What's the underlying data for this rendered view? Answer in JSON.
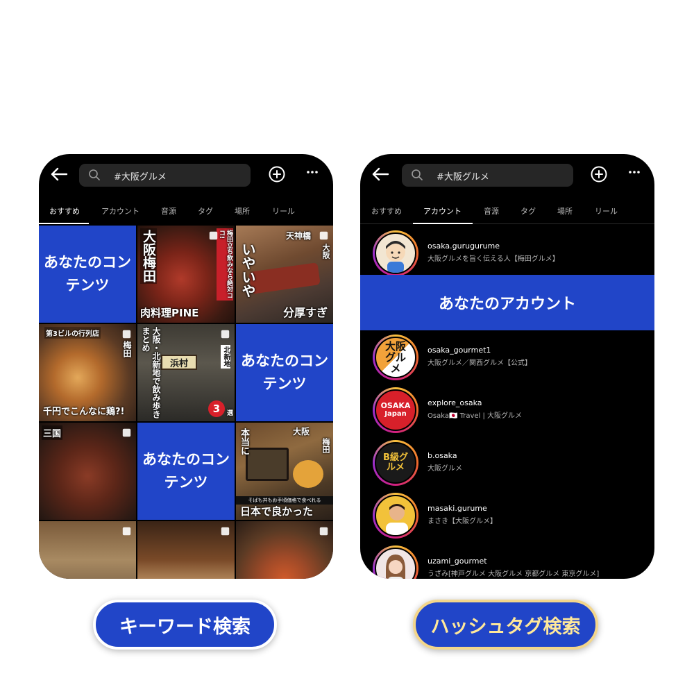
{
  "left_phone": {
    "search_text": "#大阪グルメ",
    "tabs": [
      "おすすめ",
      "アカウント",
      "音源",
      "タグ",
      "場所",
      "リール"
    ],
    "active_tab": "おすすめ",
    "your_content_label": "あなたのコンテンツ",
    "tiles": {
      "pine": {
        "big": "大阪梅田",
        "side": "梅田立ち飲みなら絶対ココ!",
        "bottom": "肉料理PINE"
      },
      "tenjin": {
        "top": "天神橋",
        "side": "大阪",
        "vert": "いやいや",
        "bottom": "分厚すぎ"
      },
      "oyakodon": {
        "top": "第3ビルの行列店",
        "side": "梅田",
        "bottom": "千円でこんなに鶏?!"
      },
      "hamamura": {
        "vert": "大阪・北新地で飲み歩きまとめ",
        "sign": "浜村",
        "side": "北新地",
        "badge": "3",
        "badge_suffix": "選"
      },
      "mikuni": {
        "top": "三国"
      },
      "soba": {
        "top": "大阪",
        "side": "梅田",
        "vert": "本当に",
        "small": "そばも丼もお手頃価格で食べれる",
        "bottom": "日本で良かった"
      }
    }
  },
  "right_phone": {
    "search_text": "#大阪グルメ",
    "tabs": [
      "おすすめ",
      "アカウント",
      "音源",
      "タグ",
      "場所",
      "リール"
    ],
    "active_tab": "アカウント",
    "your_account_label": "あなたのアカウント",
    "accounts": [
      {
        "username": "osaka.gurugurume",
        "bio": "大阪グルメを旨く伝える人【梅田グルメ】",
        "avatar_icon": "cartoon-face-icon"
      },
      {
        "username": "osaka_gourmet1",
        "bio": "大阪グルメ／関西グルメ【公式】",
        "avatar_text": "大阪グルメ"
      },
      {
        "username": "explore_osaka",
        "bio": "Osaka🇯🇵 Travel | 大阪グルメ",
        "avatar_text_top": "OSAKA",
        "avatar_text_bottom": "Japan"
      },
      {
        "username": "b.osaka",
        "bio": "大阪グルメ",
        "avatar_text": "B級グルメ"
      },
      {
        "username": "masaki.gurume",
        "bio": "まさき【大阪グルメ】",
        "avatar_icon": "person-photo-icon"
      },
      {
        "username": "uzami_gourmet",
        "bio": "うざみ[神戸グルメ 大阪グルメ 京都グルメ 東京グルメ]",
        "avatar_icon": "person-photo-icon"
      }
    ]
  },
  "captions": {
    "keyword": "キーワード検索",
    "hashtag": "ハッシュタグ検索"
  },
  "colors": {
    "brand_blue": "#2145c8",
    "caption_gold": "#f3d68b",
    "phone_bg": "#000000"
  }
}
